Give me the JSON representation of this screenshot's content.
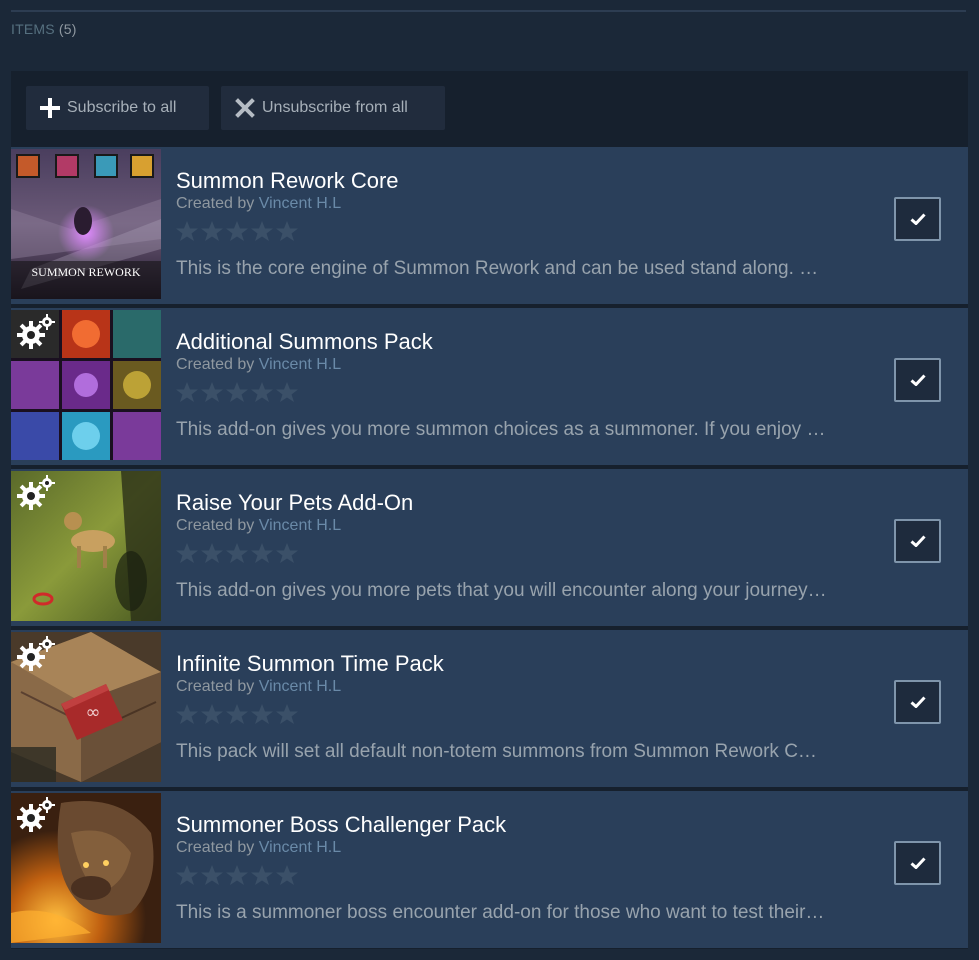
{
  "header": {
    "label": "ITEMS",
    "count": "(5)"
  },
  "toolbar": {
    "subscribe_all_label": "Subscribe to all",
    "unsubscribe_all_label": "Unsubscribe from all",
    "subscribe_icon": "plus-icon",
    "unsubscribe_icon": "x-icon"
  },
  "items": [
    {
      "title": "Summon Rework Core",
      "created_by": "Created by",
      "author": "Vincent H.L",
      "rating_stars": 0,
      "description": "This is the core engine of Summon Rework and can be used stand along. …",
      "thumb_caption": "SUMMON REWORK",
      "subscribed": true
    },
    {
      "title": "Additional Summons Pack",
      "created_by": "Created by",
      "author": "Vincent H.L",
      "rating_stars": 0,
      "description": "This add-on gives you more summon choices as a summoner. If you enjoy …",
      "subscribed": true
    },
    {
      "title": "Raise Your Pets Add-On",
      "created_by": "Created by",
      "author": "Vincent H.L",
      "rating_stars": 0,
      "description": "This add-on gives you more pets that you will encounter along your journey…",
      "subscribed": true
    },
    {
      "title": "Infinite Summon Time Pack",
      "created_by": "Created by",
      "author": "Vincent H.L",
      "rating_stars": 0,
      "description": "This pack will set all default non-totem summons from Summon Rework C…",
      "subscribed": true
    },
    {
      "title": "Summoner Boss Challenger Pack",
      "created_by": "Created by",
      "author": "Vincent H.L",
      "rating_stars": 0,
      "description": "This is a summoner boss encounter add-on for those who want to test their…",
      "subscribed": true
    }
  ],
  "colors": {
    "background": "#1b2838",
    "item_background": "#2a3f5a",
    "title": "#ffffff",
    "author_link": "#6a8aa8",
    "star_empty": "#3b5068"
  }
}
